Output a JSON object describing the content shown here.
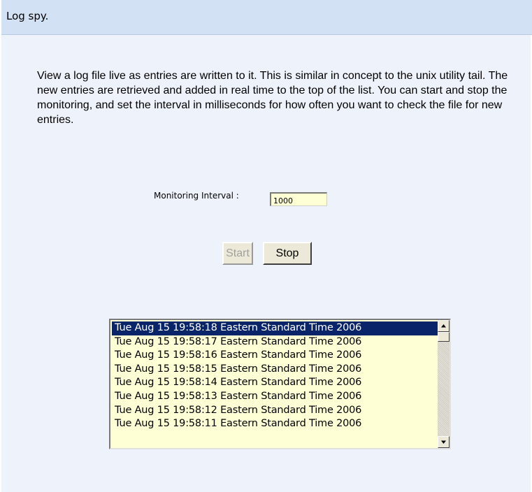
{
  "header": {
    "title": "Log spy."
  },
  "main": {
    "description": "View a log file live as entries are written to it. This is similar in concept to the unix utility tail. The new entries are retrieved and added in real time to the top of the list. You can start and stop the monitoring, and set the interval in milliseconds for how often you want to check the file for new entries.",
    "interval_label": "Monitoring Interval :",
    "interval_value": "1000",
    "start_label": "Start",
    "stop_label": "Stop",
    "start_disabled": true
  },
  "log_list": {
    "selected_index": 0,
    "entries": [
      "Tue Aug 15 19:58:18 Eastern Standard Time 2006",
      "Tue Aug 15 19:58:17 Eastern Standard Time 2006",
      "Tue Aug 15 19:58:16 Eastern Standard Time 2006",
      "Tue Aug 15 19:58:15 Eastern Standard Time 2006",
      "Tue Aug 15 19:58:14 Eastern Standard Time 2006",
      "Tue Aug 15 19:58:13 Eastern Standard Time 2006",
      "Tue Aug 15 19:58:12 Eastern Standard Time 2006",
      "Tue Aug 15 19:58:11 Eastern Standard Time 2006"
    ]
  },
  "icons": {
    "scroll_up": "triangle-up-icon",
    "scroll_down": "triangle-down-icon"
  },
  "colors": {
    "title_bar": "#d3e1f4",
    "panel_background": "#eef3fb",
    "field_background": "#ffffd6",
    "selection": "#0a246a"
  }
}
